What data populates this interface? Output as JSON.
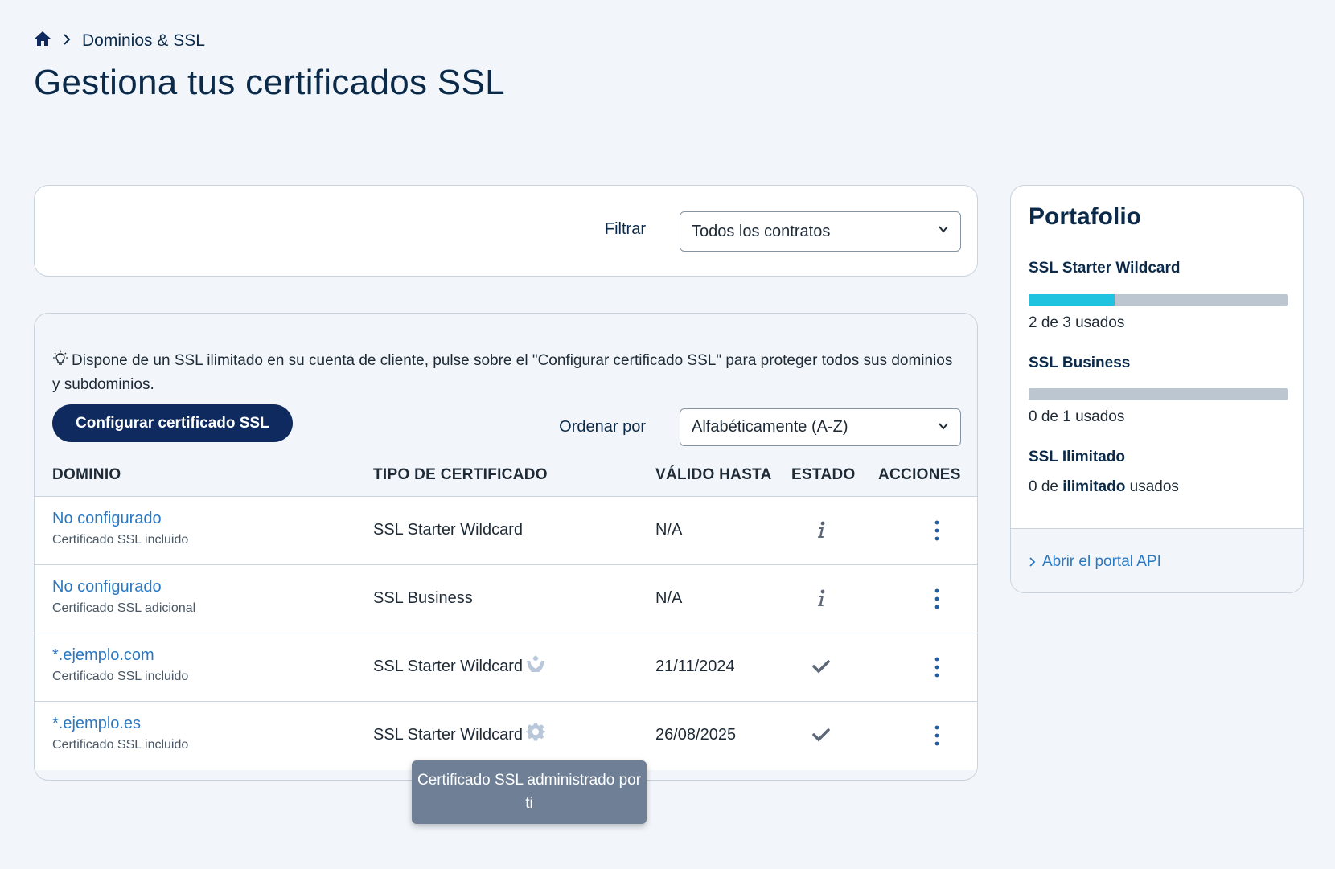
{
  "breadcrumb": {
    "home_icon": "home-icon",
    "separator_icon": "chevron-right-icon",
    "current": "Dominios & SSL"
  },
  "page": {
    "title": "Gestiona tus certificados SSL"
  },
  "filter": {
    "label": "Filtrar",
    "selected": "Todos los contratos"
  },
  "info": {
    "icon": "lightbulb-icon",
    "text": "Dispone de un SSL ilimitado en su cuenta de cliente, pulse sobre el \"Configurar certificado SSL\" para proteger todos sus dominios y subdominios."
  },
  "actions": {
    "configure_button": "Configurar certificado SSL"
  },
  "sort": {
    "label": "Ordenar por",
    "selected": "Alfabéticamente (A-Z)"
  },
  "table": {
    "headers": {
      "domain": "DOMINIO",
      "type": "TIPO DE CERTIFICADO",
      "valid": "VÁLIDO HASTA",
      "status": "ESTADO",
      "actions": "ACCIONES"
    },
    "rows": [
      {
        "domain": "No configurado",
        "sub": "Certificado SSL incluido",
        "type": "SSL Starter Wildcard",
        "type_icon": "",
        "valid": "N/A",
        "status_icon": "info-icon"
      },
      {
        "domain": "No configurado",
        "sub": "Certificado SSL adicional",
        "type": "SSL Business",
        "type_icon": "",
        "valid": "N/A",
        "status_icon": "info-icon"
      },
      {
        "domain": "*.ejemplo.com",
        "sub": "Certificado SSL incluido",
        "type": "SSL Starter Wildcard",
        "type_icon": "managed-hands-icon",
        "valid": "21/11/2024",
        "status_icon": "checkmark-icon"
      },
      {
        "domain": "*.ejemplo.es",
        "sub": "Certificado SSL incluido",
        "type": "SSL Starter Wildcard",
        "type_icon": "gear-icon",
        "valid": "26/08/2025",
        "status_icon": "checkmark-icon"
      }
    ]
  },
  "tooltip": {
    "text": "Certificado SSL administrado por ti"
  },
  "portfolio": {
    "title": "Portafolio",
    "items": [
      {
        "name": "SSL Starter Wildcard",
        "used": 2,
        "total": 3,
        "used_text": "2 de 3 usados",
        "fill_fraction": 0.333
      },
      {
        "name": "SSL Business",
        "used": 0,
        "total": 1,
        "used_text": "0 de 1 usados",
        "fill_fraction": 0
      },
      {
        "name": "SSL Ilimitado",
        "used_prefix": "0 de ",
        "used_bold": "ilimitado",
        "used_suffix": " usados"
      }
    ],
    "api_link": "Abrir el portal API"
  },
  "colors": {
    "brand_navy": "#0f2a5e",
    "link_blue": "#2b78c2",
    "progress_cyan": "#1fc3e0",
    "tooltip_bg": "#6e7f96"
  }
}
